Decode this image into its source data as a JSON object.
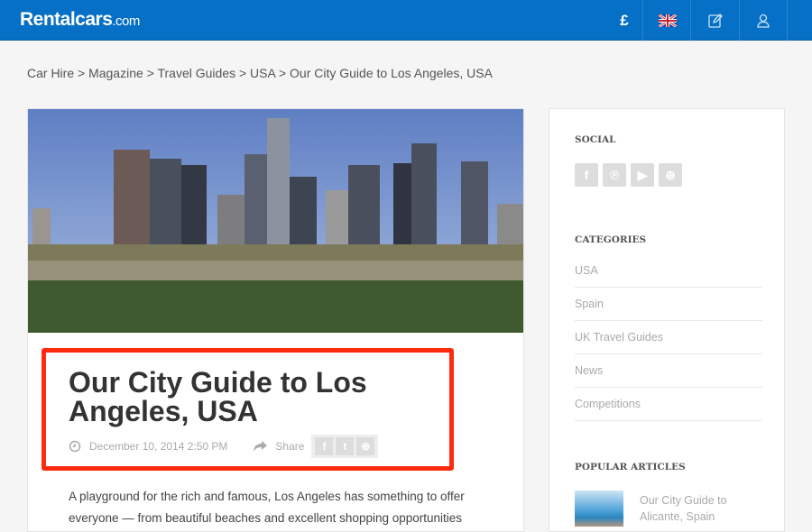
{
  "header": {
    "logo": "Rentalcars",
    "logo_suffix": ".com",
    "currency": "£",
    "language_icon": "uk-flag-icon",
    "brand_color": "#0670c6"
  },
  "breadcrumb": "Car Hire > Magazine > Travel Guides > USA > Our City Guide to Los Angeles, USA",
  "article": {
    "title": "Our City Guide to Los Angeles, USA",
    "date": "December 10, 2014 2:50 PM",
    "share_label": "Share",
    "body": "A playground for the rich and famous, Los Angeles has something to offer everyone — from beautiful beaches and excellent shopping opportunities",
    "highlight_color": "#ff2a0f"
  },
  "sidebar": {
    "social_heading": "SOCIAL",
    "categories_heading": "CATEGORIES",
    "categories": [
      "USA",
      "Spain",
      "UK Travel Guides",
      "News",
      "Competitions"
    ],
    "popular_heading": "POPULAR ARTICLES",
    "popular": [
      {
        "title": "Our City Guide to Alicante, Spain"
      }
    ]
  }
}
